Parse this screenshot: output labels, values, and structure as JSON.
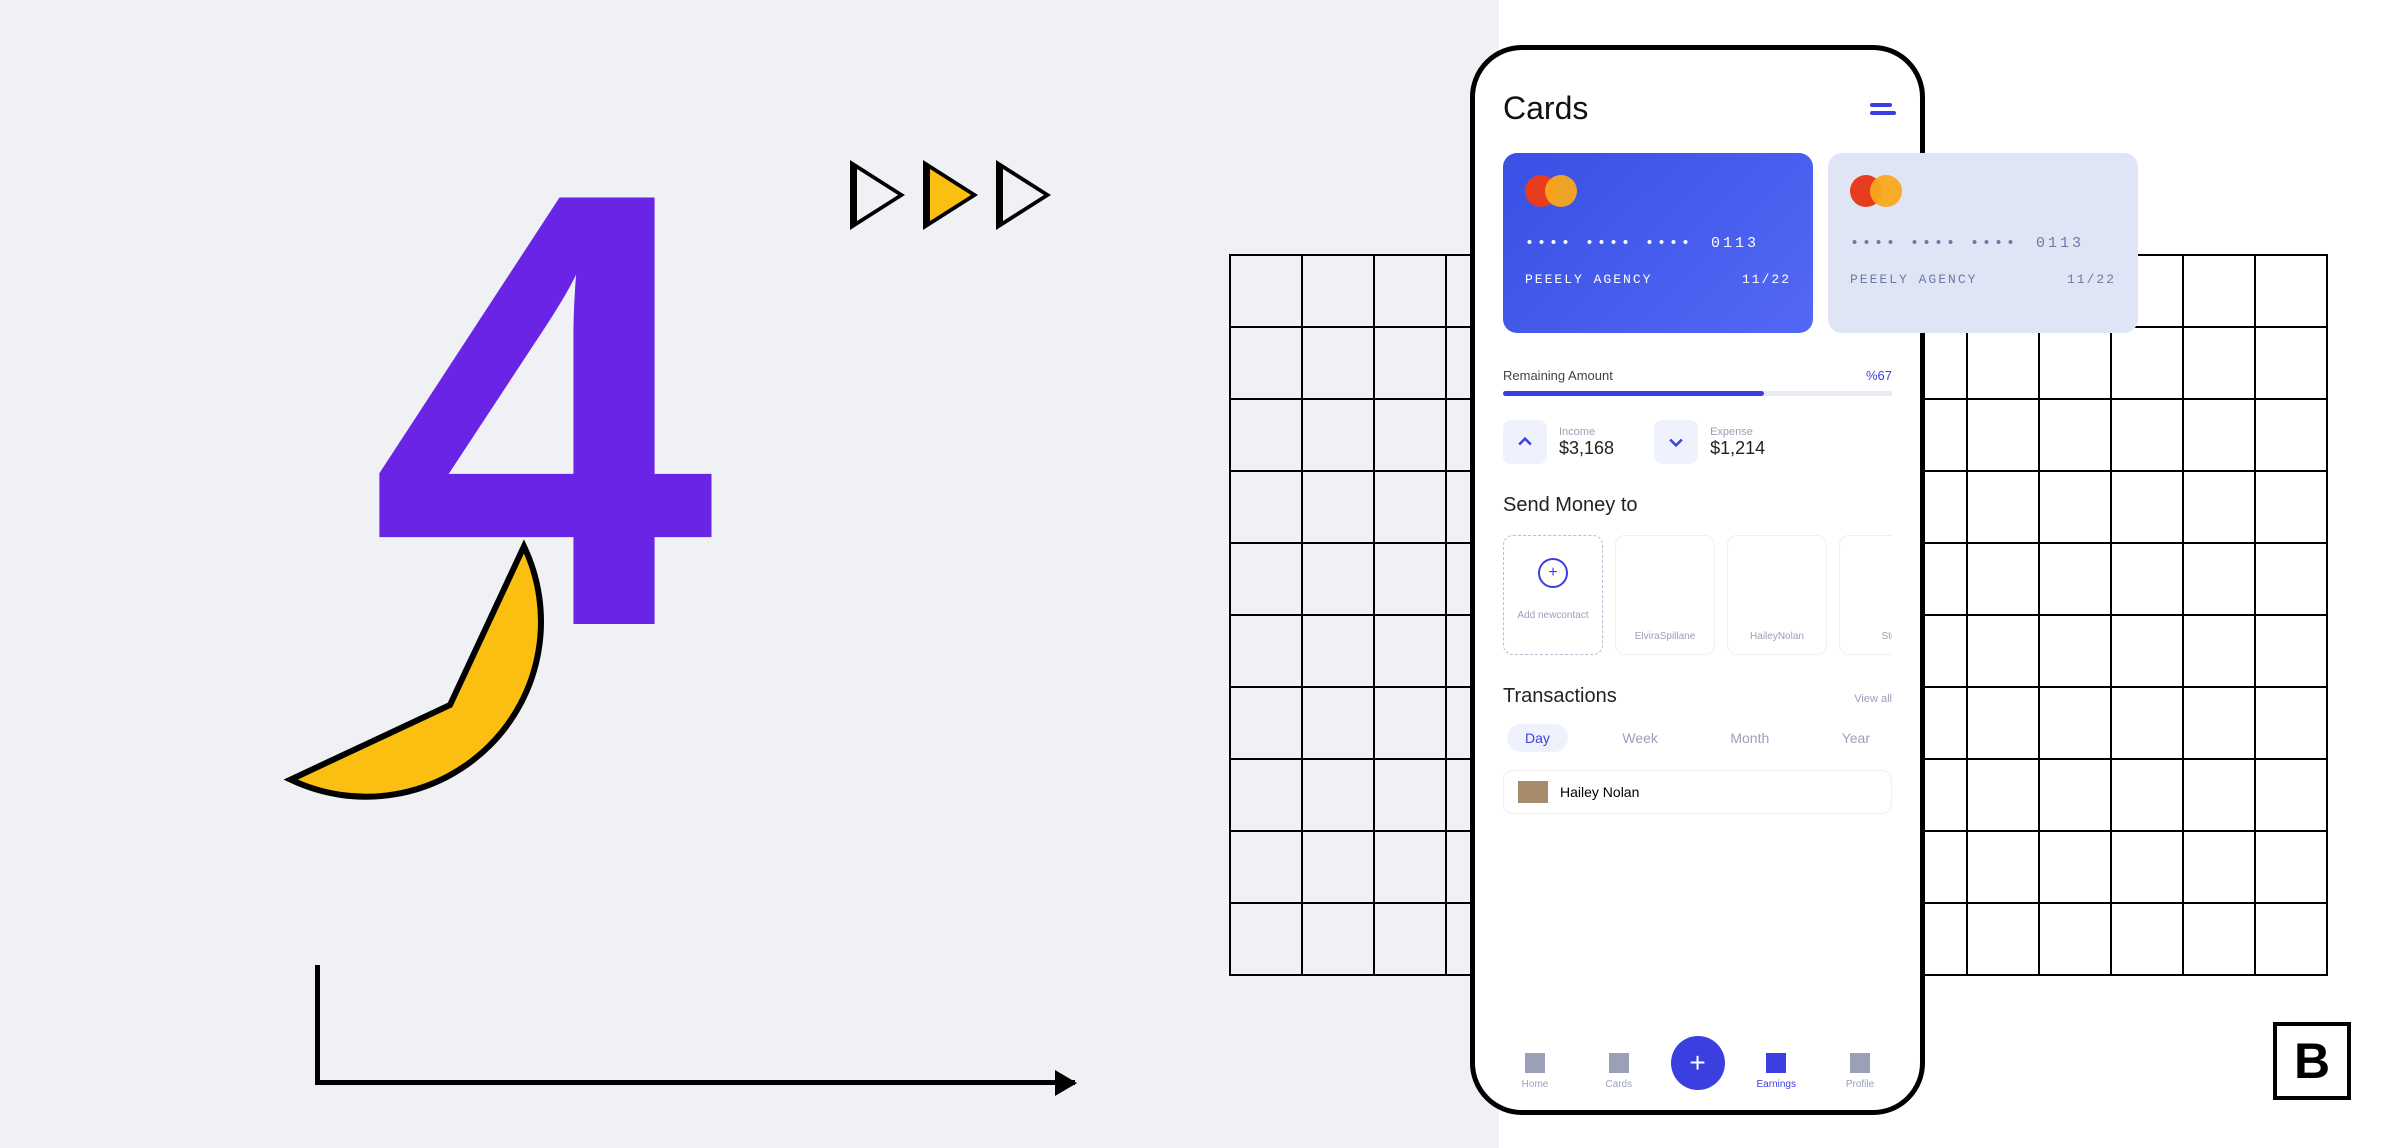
{
  "phone": {
    "title": "Cards",
    "cards": [
      {
        "masked": "•••• •••• ••••",
        "last4": "0113",
        "holder": "PEEELY AGENCY",
        "expiry": "11/22"
      },
      {
        "masked": "•••• •••• ••••",
        "last4": "0113",
        "holder": "PEEELY AGENCY",
        "expiry": "11/22"
      }
    ],
    "remaining": {
      "label": "Remaining Amount",
      "percent": "%67",
      "value": 67
    },
    "income": {
      "label": "Income",
      "value": "$3,168"
    },
    "expense": {
      "label": "Expense",
      "value": "$1,214"
    },
    "sendMoney": {
      "title": "Send Money to",
      "add": "Add newcontact",
      "contacts": [
        "ElviraSpillane",
        "HaileyNolan",
        "Ste"
      ]
    },
    "transactions": {
      "title": "Transactions",
      "viewAll": "View all",
      "tabs": [
        "Day",
        "Week",
        "Month",
        "Year"
      ],
      "activeTab": "Day",
      "items": [
        {
          "name": "Hailey Nolan"
        }
      ]
    },
    "nav": {
      "items": [
        "Home",
        "Cards",
        "Earnings",
        "Profile"
      ],
      "active": "Earnings"
    }
  },
  "logo": "B"
}
